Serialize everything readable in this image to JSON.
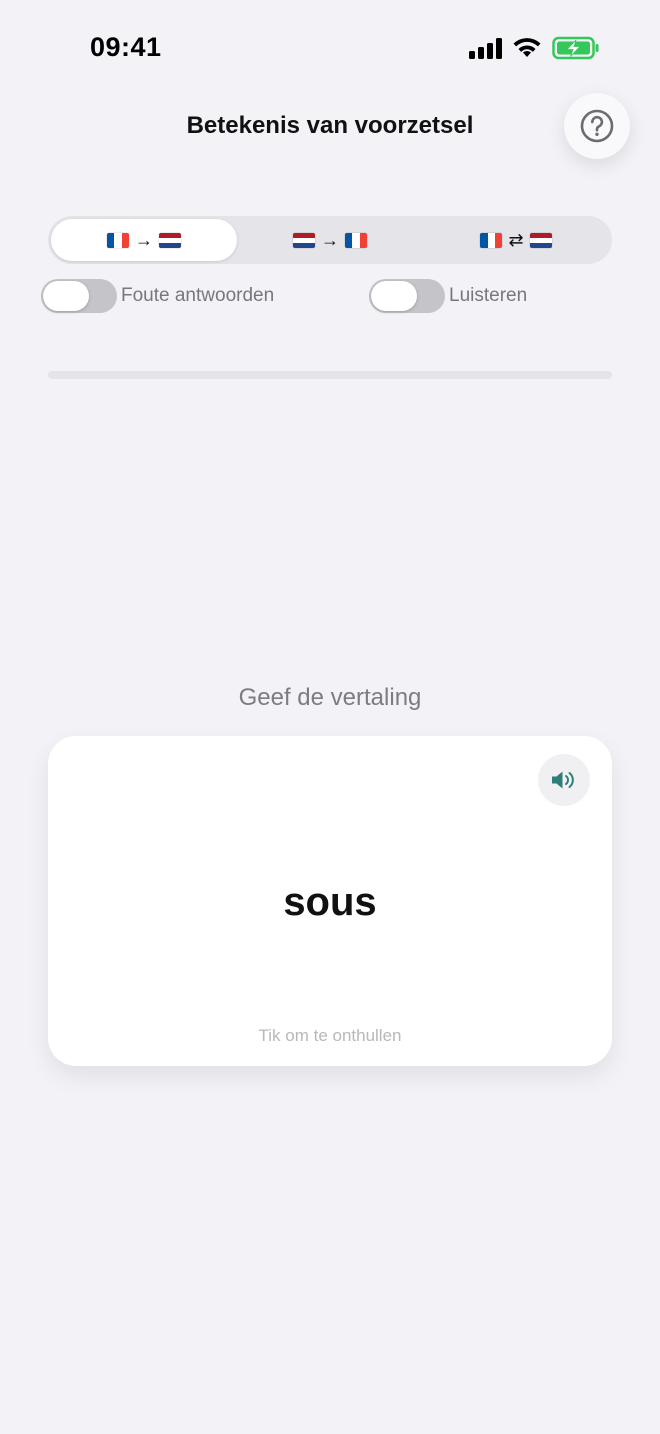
{
  "status_bar": {
    "time": "09:41"
  },
  "header": {
    "title": "Betekenis van voorzetsel",
    "help_icon": "question-circle-icon"
  },
  "direction_selector": {
    "selected_index": 0,
    "options": [
      {
        "from": "FR",
        "to": "NL",
        "arrow": "→"
      },
      {
        "from": "NL",
        "to": "FR",
        "arrow": "→"
      },
      {
        "from": "FR",
        "to": "NL",
        "arrow": "⇄"
      }
    ]
  },
  "toggles": {
    "wrong_answers": {
      "label": "Foute antwoorden",
      "on": false
    },
    "listen": {
      "label": "Luisteren",
      "on": false
    }
  },
  "progress": {
    "value": 0
  },
  "exercise": {
    "prompt": "Geef de vertaling",
    "word": "sous",
    "hint": "Tik om te onthullen",
    "speaker_icon": "speaker-icon"
  },
  "colors": {
    "background": "#f2f2f7",
    "accent_teal": "#2f7d78",
    "battery_green": "#34c759",
    "fr_blue": "#0055a4",
    "fr_red": "#ef4135",
    "nl_red": "#ae1c28",
    "nl_blue": "#21468b"
  }
}
